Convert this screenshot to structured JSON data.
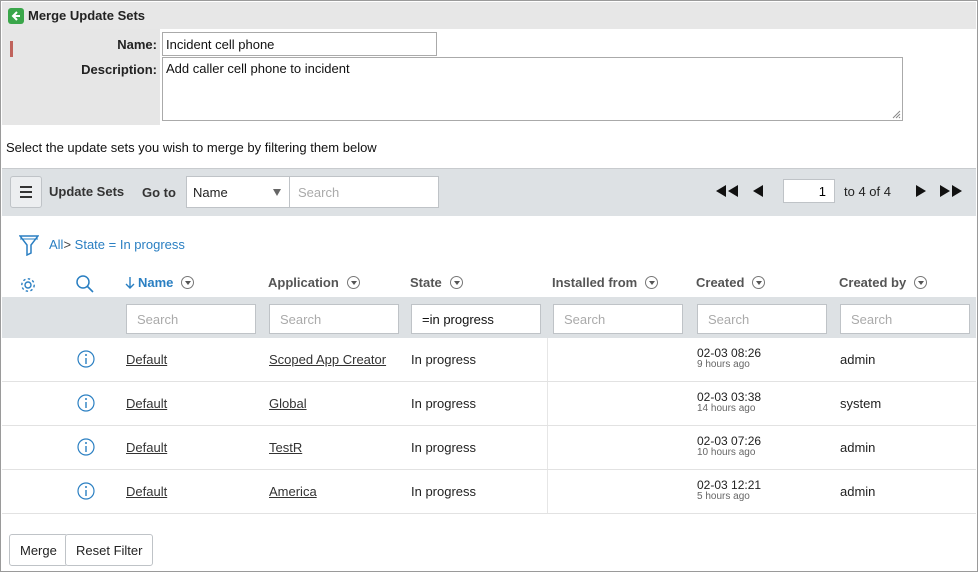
{
  "titlebar": {
    "title": "Merge Update Sets"
  },
  "form": {
    "name_label": "Name:",
    "name_value": "Incident cell phone",
    "description_label": "Description:",
    "description_value": "Add caller cell phone to incident"
  },
  "instructions": "Select the update sets you wish to merge by filtering them below",
  "toolbar": {
    "title": "Update Sets",
    "goto_label": "Go to",
    "goto_field": "Name",
    "search_placeholder": "Search",
    "page_value": "1",
    "page_text": "to 4 of 4"
  },
  "breadcrumb": {
    "all": "All",
    "separator": ">",
    "condition": "State = In progress"
  },
  "table": {
    "columns": [
      "Name",
      "Application",
      "State",
      "Installed from",
      "Created",
      "Created by"
    ],
    "filters": [
      "Search",
      "Search",
      "=in progress",
      "Search",
      "Search",
      "Search"
    ],
    "rows": [
      {
        "name": "Default",
        "application": "Scoped App Creator",
        "state": "In progress",
        "installed_from": "",
        "created": "02-03 08:26",
        "created_ago": "9 hours ago",
        "created_by": "admin"
      },
      {
        "name": "Default",
        "application": "Global",
        "state": "In progress",
        "installed_from": "",
        "created": "02-03 03:38",
        "created_ago": "14 hours ago",
        "created_by": "system"
      },
      {
        "name": "Default",
        "application": "TestR",
        "state": "In progress",
        "installed_from": "",
        "created": "02-03 07:26",
        "created_ago": "10 hours ago",
        "created_by": "admin"
      },
      {
        "name": "Default",
        "application": "America",
        "state": "In progress",
        "installed_from": "",
        "created": "02-03 12:21",
        "created_ago": "5 hours ago",
        "created_by": "admin"
      }
    ]
  },
  "buttons": {
    "merge": "Merge",
    "reset_filter": "Reset Filter"
  },
  "colors": {
    "accent_blue": "#2a7fc2",
    "back_green": "#3aa64a",
    "toolbar_bg": "#dde1e4",
    "required_mark": "#c0635c"
  },
  "icons": [
    "back-arrow-icon",
    "hamburger-menu-icon",
    "first-page-icon",
    "previous-page-icon",
    "next-page-icon",
    "last-page-icon",
    "filter-funnel-icon",
    "gear-icon",
    "search-icon",
    "info-icon"
  ]
}
